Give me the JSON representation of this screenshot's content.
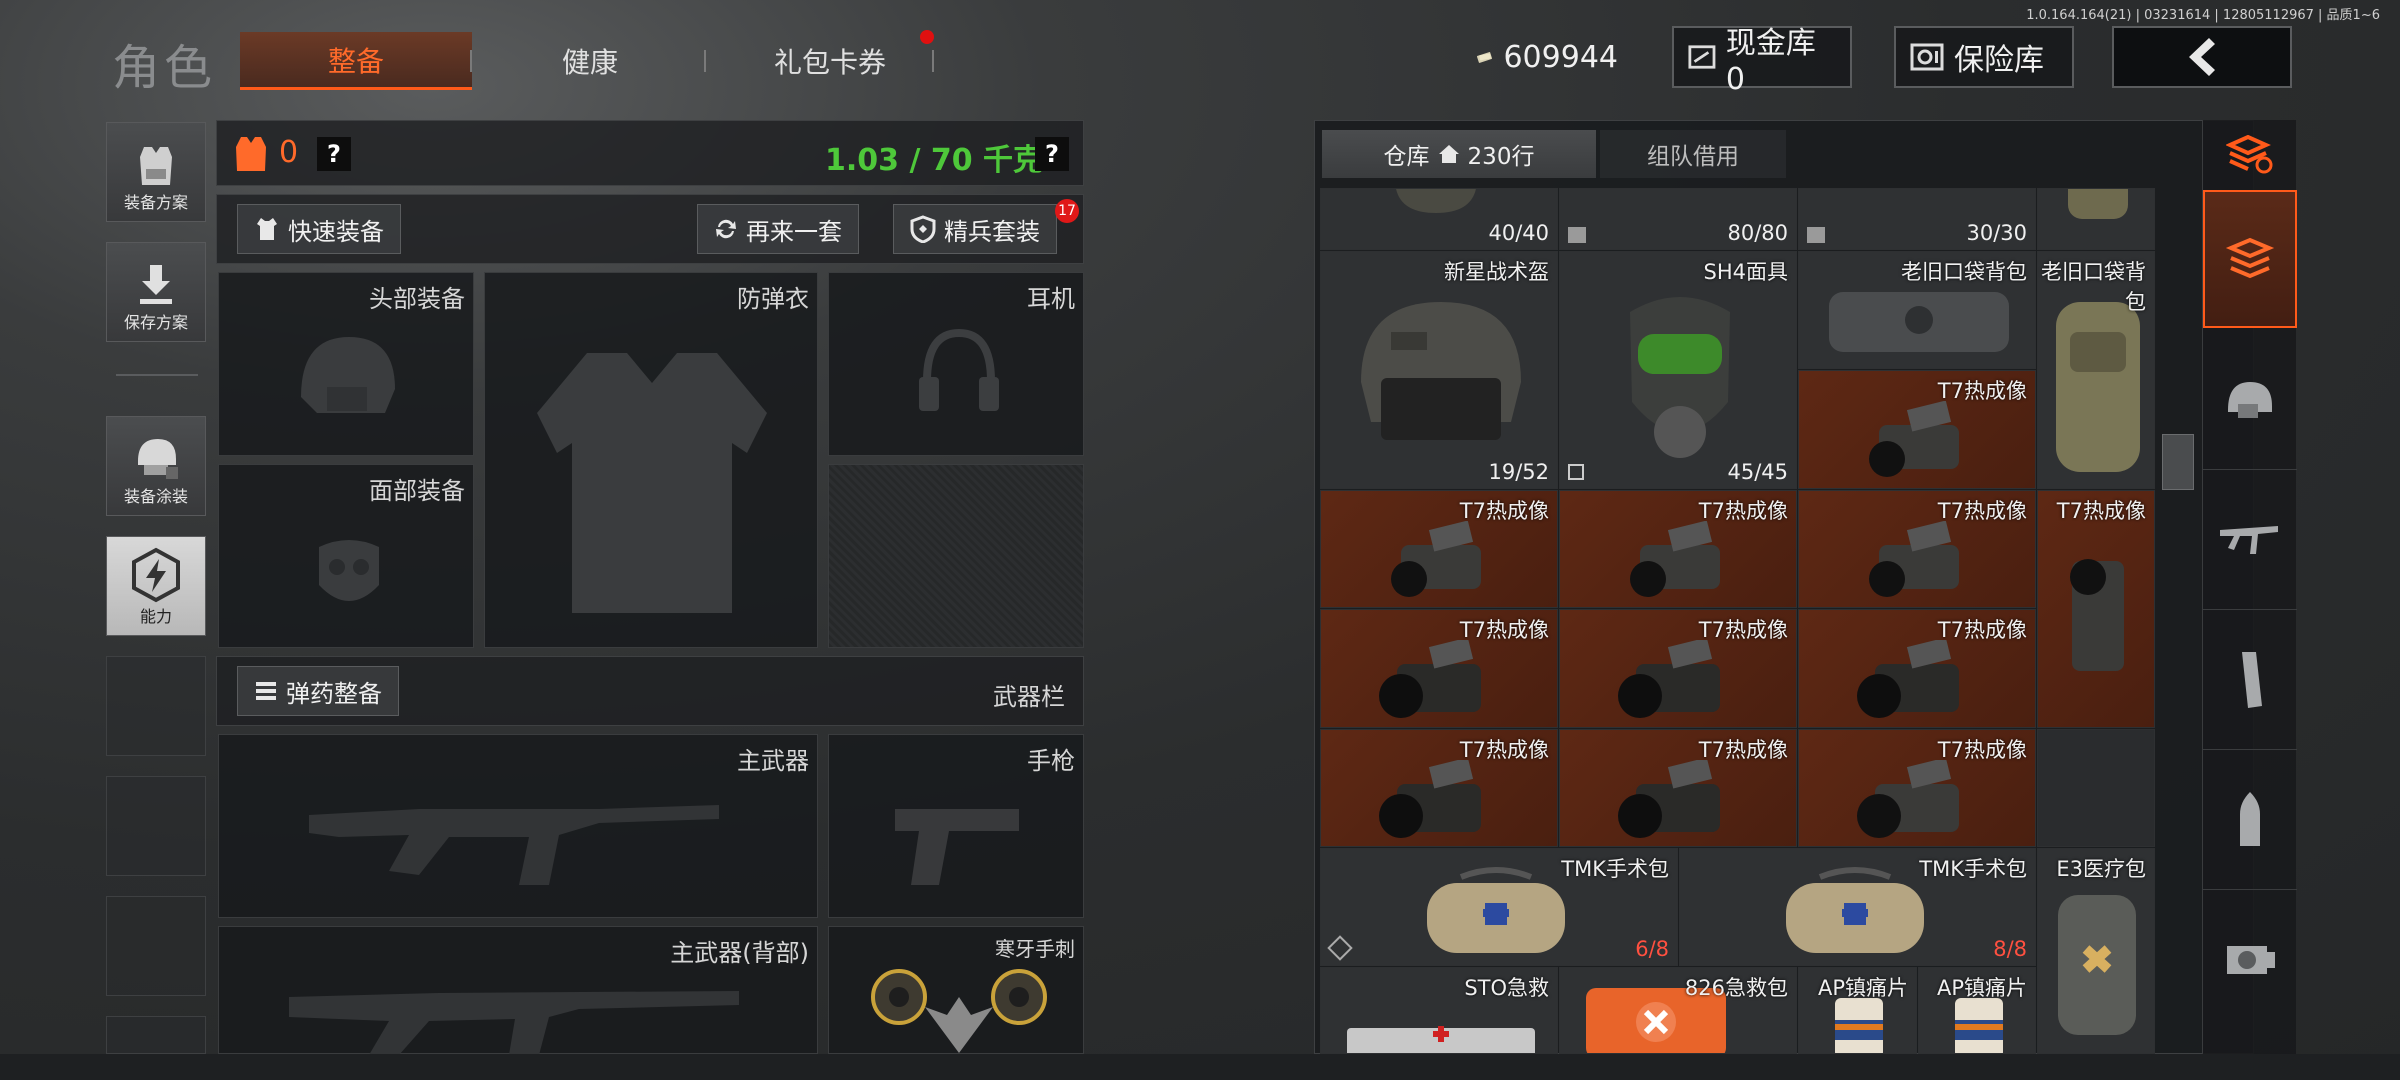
{
  "version": "1.0.164.164(21) | 03231614 | 12805112967 | 品质1~6",
  "title": "角色",
  "tabs": [
    {
      "label": "整备",
      "active": true
    },
    {
      "label": "健康",
      "active": false
    },
    {
      "label": "礼包卡券",
      "active": false
    }
  ],
  "currency": {
    "value": "609944",
    "icon": "cash-icon"
  },
  "cash_vault": {
    "label": "现金库 0"
  },
  "safe": {
    "label": "保险库"
  },
  "left_sidebar": [
    {
      "label": "装备方案",
      "icon": "vest-loadout-icon"
    },
    {
      "label": "保存方案",
      "icon": "save-download-icon"
    },
    {
      "label": "装备涂装",
      "icon": "paint-helmet-icon"
    },
    {
      "label": "能力",
      "icon": "lightning-icon"
    }
  ],
  "loadout": {
    "armor_count": "0",
    "weight": "1.03 / 70 千克",
    "help": "?",
    "quick_equip": "快速装备",
    "reequip": "再来一套",
    "elite_set": "精兵套装",
    "elite_badge": "17",
    "slots": {
      "head": "头部装备",
      "vest": "防弹衣",
      "headset": "耳机",
      "face": "面部装备"
    },
    "ammo_equip": "弹药整备",
    "weapon_bar": "武器栏",
    "weapons": {
      "primary": "主武器",
      "pistol": "手枪",
      "primary_back": "主武器(背部)",
      "melee": "寒牙手刺"
    }
  },
  "warehouse": {
    "tab_storage": "仓库",
    "rows": "230行",
    "tab_team": "组队借用",
    "top_counts": [
      "40/40",
      "80/80",
      "30/30"
    ],
    "items": [
      {
        "name": "新星战术盔",
        "count": "19/52"
      },
      {
        "name": "SH4面具",
        "count": "45/45"
      },
      {
        "name": "老旧口袋背包",
        "count": ""
      },
      {
        "name": "老旧口袋背包",
        "count": ""
      },
      {
        "name": "T7热成像",
        "count": ""
      },
      {
        "name": "T7热成像",
        "count": ""
      },
      {
        "name": "T7热成像",
        "count": ""
      },
      {
        "name": "T7热成像",
        "count": ""
      },
      {
        "name": "T7热成像",
        "count": ""
      },
      {
        "name": "T7热成像",
        "count": ""
      },
      {
        "name": "T7热成像",
        "count": ""
      },
      {
        "name": "T7热成像",
        "count": ""
      },
      {
        "name": "T7热成像",
        "count": ""
      },
      {
        "name": "T7热成像",
        "count": ""
      },
      {
        "name": "T7热成像",
        "count": ""
      },
      {
        "name": "TMK手术包",
        "count": "6/8"
      },
      {
        "name": "TMK手术包",
        "count": "8/8"
      },
      {
        "name": "E3医疗包",
        "count": ""
      },
      {
        "name": "STO急救",
        "count": ""
      },
      {
        "name": "826急救包",
        "count": ""
      },
      {
        "name": "AP镇痛片",
        "count": ""
      },
      {
        "name": "AP镇痛片",
        "count": ""
      }
    ]
  },
  "right_filters": [
    "sort-stack-icon",
    "equipment-tab-icon",
    "helmet-filter-icon",
    "rifle-filter-icon",
    "magazine-filter-icon",
    "ammo-filter-icon",
    "scope-filter-icon"
  ],
  "colors": {
    "accent": "#ff5a1a",
    "weight_green": "#4ec83a",
    "rare_red": "#5e2814"
  }
}
